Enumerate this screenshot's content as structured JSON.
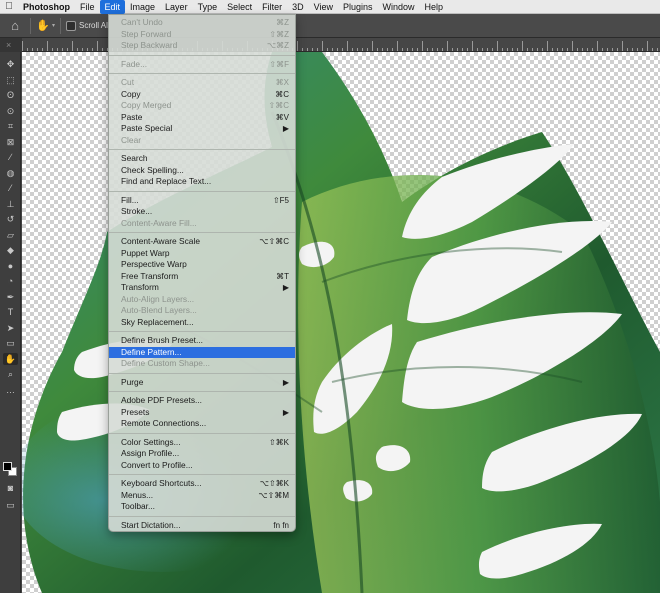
{
  "menubar": {
    "apple_icon": "",
    "items": [
      "Photoshop",
      "File",
      "Edit",
      "Image",
      "Layer",
      "Type",
      "Select",
      "Filter",
      "3D",
      "View",
      "Plugins",
      "Window",
      "Help"
    ],
    "active_index": 2
  },
  "options_bar": {
    "home_icon": "⌂",
    "tool_icon": "✋",
    "caret": "▾",
    "scroll_all_label": "Scroll All"
  },
  "tab": {
    "close_icon": "×"
  },
  "toolbar": {
    "tools": [
      {
        "name": "move-tool-icon",
        "glyph": "✥"
      },
      {
        "name": "marquee-tool-icon",
        "glyph": "⬚"
      },
      {
        "name": "lasso-tool-icon",
        "glyph": "ʘ"
      },
      {
        "name": "quick-select-tool-icon",
        "glyph": "⊙"
      },
      {
        "name": "crop-tool-icon",
        "glyph": "⌗"
      },
      {
        "name": "frame-tool-icon",
        "glyph": "⊠"
      },
      {
        "name": "eyedropper-tool-icon",
        "glyph": "∕"
      },
      {
        "name": "healing-brush-tool-icon",
        "glyph": "◍"
      },
      {
        "name": "brush-tool-icon",
        "glyph": "⁄"
      },
      {
        "name": "clone-stamp-tool-icon",
        "glyph": "⊥"
      },
      {
        "name": "history-brush-tool-icon",
        "glyph": "↺"
      },
      {
        "name": "eraser-tool-icon",
        "glyph": "▱"
      },
      {
        "name": "paint-bucket-tool-icon",
        "glyph": "◆"
      },
      {
        "name": "blur-tool-icon",
        "glyph": "●"
      },
      {
        "name": "dodge-tool-icon",
        "glyph": "◔"
      },
      {
        "name": "pen-tool-icon",
        "glyph": "✒"
      },
      {
        "name": "type-tool-icon",
        "glyph": "T"
      },
      {
        "name": "path-select-tool-icon",
        "glyph": "➤"
      },
      {
        "name": "shape-tool-icon",
        "glyph": "▭"
      },
      {
        "name": "hand-tool-icon",
        "glyph": "✋"
      },
      {
        "name": "zoom-tool-icon",
        "glyph": "⌕"
      },
      {
        "name": "more-tools-icon",
        "glyph": "…"
      }
    ],
    "active_tool": "hand-tool-icon",
    "bottom_icons": [
      "quick-mask-icon",
      "screen-mode-icon"
    ]
  },
  "edit_menu": {
    "items": [
      {
        "label": "Can't Undo",
        "shortcut": "⌘Z",
        "disabled": true
      },
      {
        "label": "Step Forward",
        "shortcut": "⇧⌘Z",
        "disabled": true
      },
      {
        "label": "Step Backward",
        "shortcut": "⌥⌘Z",
        "disabled": true
      },
      {
        "sep": true
      },
      {
        "label": "Fade...",
        "shortcut": "⇧⌘F",
        "disabled": true
      },
      {
        "sep": true
      },
      {
        "label": "Cut",
        "shortcut": "⌘X",
        "disabled": true
      },
      {
        "label": "Copy",
        "shortcut": "⌘C"
      },
      {
        "label": "Copy Merged",
        "shortcut": "⇧⌘C",
        "disabled": true
      },
      {
        "label": "Paste",
        "shortcut": "⌘V"
      },
      {
        "label": "Paste Special",
        "shortcut": "▶"
      },
      {
        "label": "Clear",
        "disabled": true
      },
      {
        "sep": true
      },
      {
        "label": "Search"
      },
      {
        "label": "Check Spelling..."
      },
      {
        "label": "Find and Replace Text..."
      },
      {
        "sep": true
      },
      {
        "label": "Fill...",
        "shortcut": "⇧F5"
      },
      {
        "label": "Stroke..."
      },
      {
        "label": "Content-Aware Fill...",
        "disabled": true
      },
      {
        "sep": true
      },
      {
        "label": "Content-Aware Scale",
        "shortcut": "⌥⇧⌘C"
      },
      {
        "label": "Puppet Warp"
      },
      {
        "label": "Perspective Warp"
      },
      {
        "label": "Free Transform",
        "shortcut": "⌘T"
      },
      {
        "label": "Transform",
        "shortcut": "▶"
      },
      {
        "label": "Auto-Align Layers...",
        "disabled": true
      },
      {
        "label": "Auto-Blend Layers...",
        "disabled": true
      },
      {
        "label": "Sky Replacement..."
      },
      {
        "sep": true
      },
      {
        "label": "Define Brush Preset..."
      },
      {
        "label": "Define Pattern...",
        "highlighted": true
      },
      {
        "label": "Define Custom Shape...",
        "disabled": true
      },
      {
        "sep": true
      },
      {
        "label": "Purge",
        "shortcut": "▶"
      },
      {
        "sep": true
      },
      {
        "label": "Adobe PDF Presets..."
      },
      {
        "label": "Presets",
        "shortcut": "▶"
      },
      {
        "label": "Remote Connections..."
      },
      {
        "sep": true
      },
      {
        "label": "Color Settings...",
        "shortcut": "⇧⌘K"
      },
      {
        "label": "Assign Profile..."
      },
      {
        "label": "Convert to Profile..."
      },
      {
        "sep": true
      },
      {
        "label": "Keyboard Shortcuts...",
        "shortcut": "⌥⇧⌘K"
      },
      {
        "label": "Menus...",
        "shortcut": "⌥⇧⌘M"
      },
      {
        "label": "Toolbar..."
      },
      {
        "sep": true
      },
      {
        "label": "Start Dictation...",
        "shortcut": "fn fn"
      }
    ]
  },
  "colors": {
    "menubar_active": "#1e6fdc",
    "menu_highlight": "#2c6ee0",
    "leaf_dark": "#1f5a2e",
    "leaf_mid": "#3f8a3c",
    "leaf_light": "#9fc65a",
    "leaf_teal": "#2f8a86"
  }
}
